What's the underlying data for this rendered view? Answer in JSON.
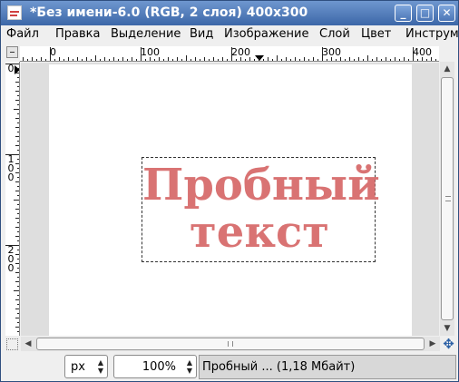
{
  "window": {
    "title": "*Без имени-6.0 (RGB, 2 слоя) 400x300",
    "minimize_glyph": "_",
    "maximize_glyph": "□",
    "close_glyph": "✕"
  },
  "menu": [
    "Файл",
    "Правка",
    "Выделение",
    "Вид",
    "Изображение",
    "Слой",
    "Цвет",
    "Инструм"
  ],
  "ruler": {
    "h_labels": [
      "0",
      "100",
      "200",
      "300",
      "400"
    ],
    "v_labels": [
      "0",
      "100",
      "200"
    ]
  },
  "canvas": {
    "text_line1": "Пробный",
    "text_line2": "текст",
    "text_color": "#d97373",
    "background": "#ffffff"
  },
  "statusbar": {
    "unit": "px",
    "zoom": "100%",
    "message": "Пробный ... (1,18 Мбайт)"
  },
  "icons": {
    "navigate": "✥",
    "up": "▲",
    "down": "▼",
    "left": "◀",
    "right": "▶"
  }
}
